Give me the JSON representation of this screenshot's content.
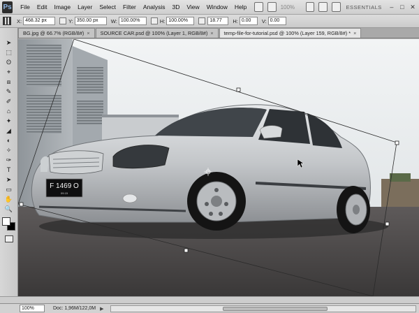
{
  "app": {
    "logo": "Ps",
    "menu": [
      "File",
      "Edit",
      "Image",
      "Layer",
      "Select",
      "Filter",
      "Analysis",
      "3D",
      "View",
      "Window",
      "Help"
    ],
    "zoom_menu": "100%",
    "workspace": "ESSENTIALS",
    "window_controls": [
      "–",
      "□",
      "✕"
    ]
  },
  "options": {
    "x_label": "X:",
    "x_value": "468.32 px",
    "y_label": "Y:",
    "y_value": "350.00 px",
    "w_label": "W:",
    "w_value": "100.00%",
    "h_label": "H:",
    "h_value": "100.00%",
    "angle_value": "18.77",
    "hskew_label": "H:",
    "hskew_value": "0.00",
    "vskew_label": "V:",
    "vskew_value": "0.00"
  },
  "tabs": [
    {
      "label": "BG.jpg @ 66.7% (RGB/8#)",
      "close": "×"
    },
    {
      "label": "SOURCE CAR.psd @ 100% (Layer 1, RGB/8#)",
      "close": "×"
    },
    {
      "label": "temp-file-for-tutorial.psd @ 100% (Layer 159, RGB/8#) *",
      "close": "×"
    }
  ],
  "tools": [
    "➤",
    "⬚",
    "ʘ",
    "⌖",
    "⧈",
    "✎",
    "✐",
    "⌂",
    "✦",
    "◢",
    "◐",
    "✧",
    "✑",
    "T",
    "➤",
    "▭",
    "✋",
    "🔍"
  ],
  "car": {
    "plate": "F 1469 O",
    "plate_sub": "09.15"
  },
  "status": {
    "zoom": "100%",
    "doc": "Doc: 1,96M/122,0M",
    "arrow": "▶"
  },
  "colors": {
    "accent": "#8fb8e8",
    "chrome": "#d0d0d0"
  }
}
